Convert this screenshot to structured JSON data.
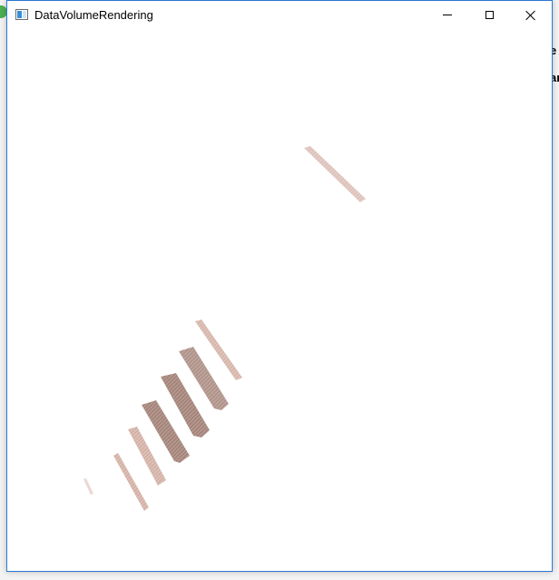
{
  "window": {
    "title": "DataVolumeRendering",
    "icon": "app-window-icon",
    "controls": {
      "minimize_icon": "minimize-icon",
      "maximize_icon": "maximize-icon",
      "close_icon": "close-icon"
    },
    "border_color": "#2b78d4"
  },
  "background": {
    "partial_text": "e\nI\nar"
  },
  "render": {
    "type": "volume-rendering",
    "volume_color": "#c9a093",
    "dark_color": "#7d5f56"
  }
}
